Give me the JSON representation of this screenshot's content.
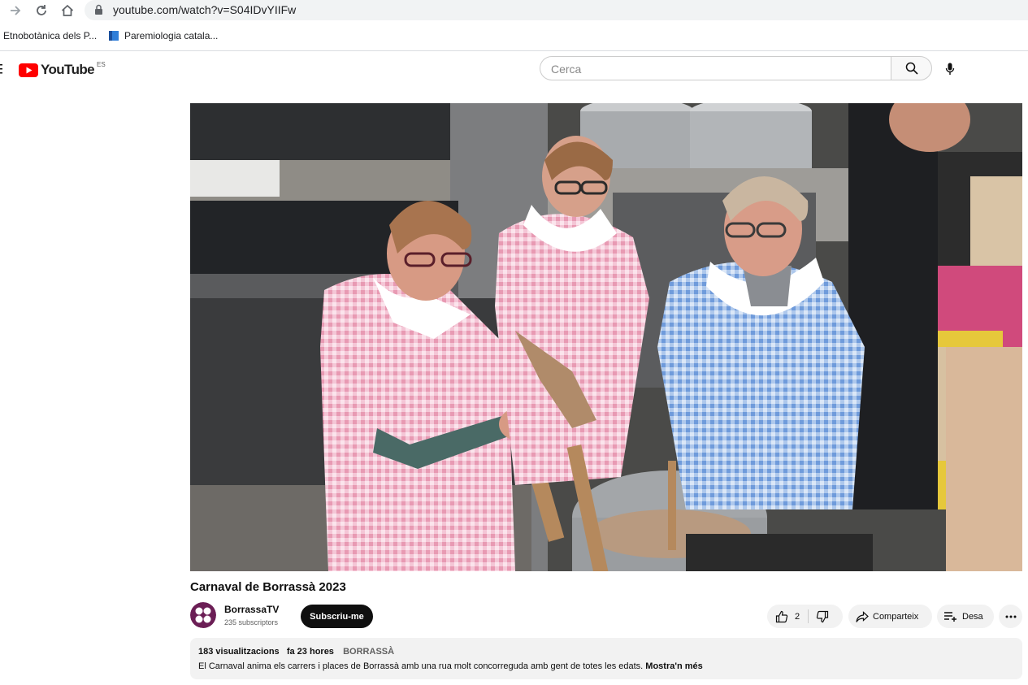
{
  "browser": {
    "url": "youtube.com/watch?v=S04IDvYIIFw",
    "bookmarks": [
      {
        "label": "Etnobotànica dels P..."
      },
      {
        "label": "Paremiologia catala..."
      }
    ]
  },
  "header": {
    "logo_text": "YouTube",
    "region": "ES",
    "search_placeholder": "Cerca"
  },
  "video": {
    "title": "Carnaval de Borrassà 2023"
  },
  "channel": {
    "name": "BorrassaTV",
    "subscribers": "235 subscriptors",
    "subscribe_label": "Subscriu-me"
  },
  "actions": {
    "like_count": "2",
    "share_label": "Comparteix",
    "save_label": "Desa"
  },
  "description": {
    "views": "183 visualitzacions",
    "date": "fa 23 hores",
    "hashtag": "BORRASSÀ",
    "text": "El Carnaval anima els carrers i places de Borrassà amb una rua molt concorreguda amb gent de totes les edats.",
    "more_label": "Mostra'n més"
  },
  "colors": {
    "brand_red": "#ff0000",
    "subscribe_bg": "#0f0f0f",
    "chip_bg": "#f2f2f2",
    "avatar": "#6b1e55"
  }
}
